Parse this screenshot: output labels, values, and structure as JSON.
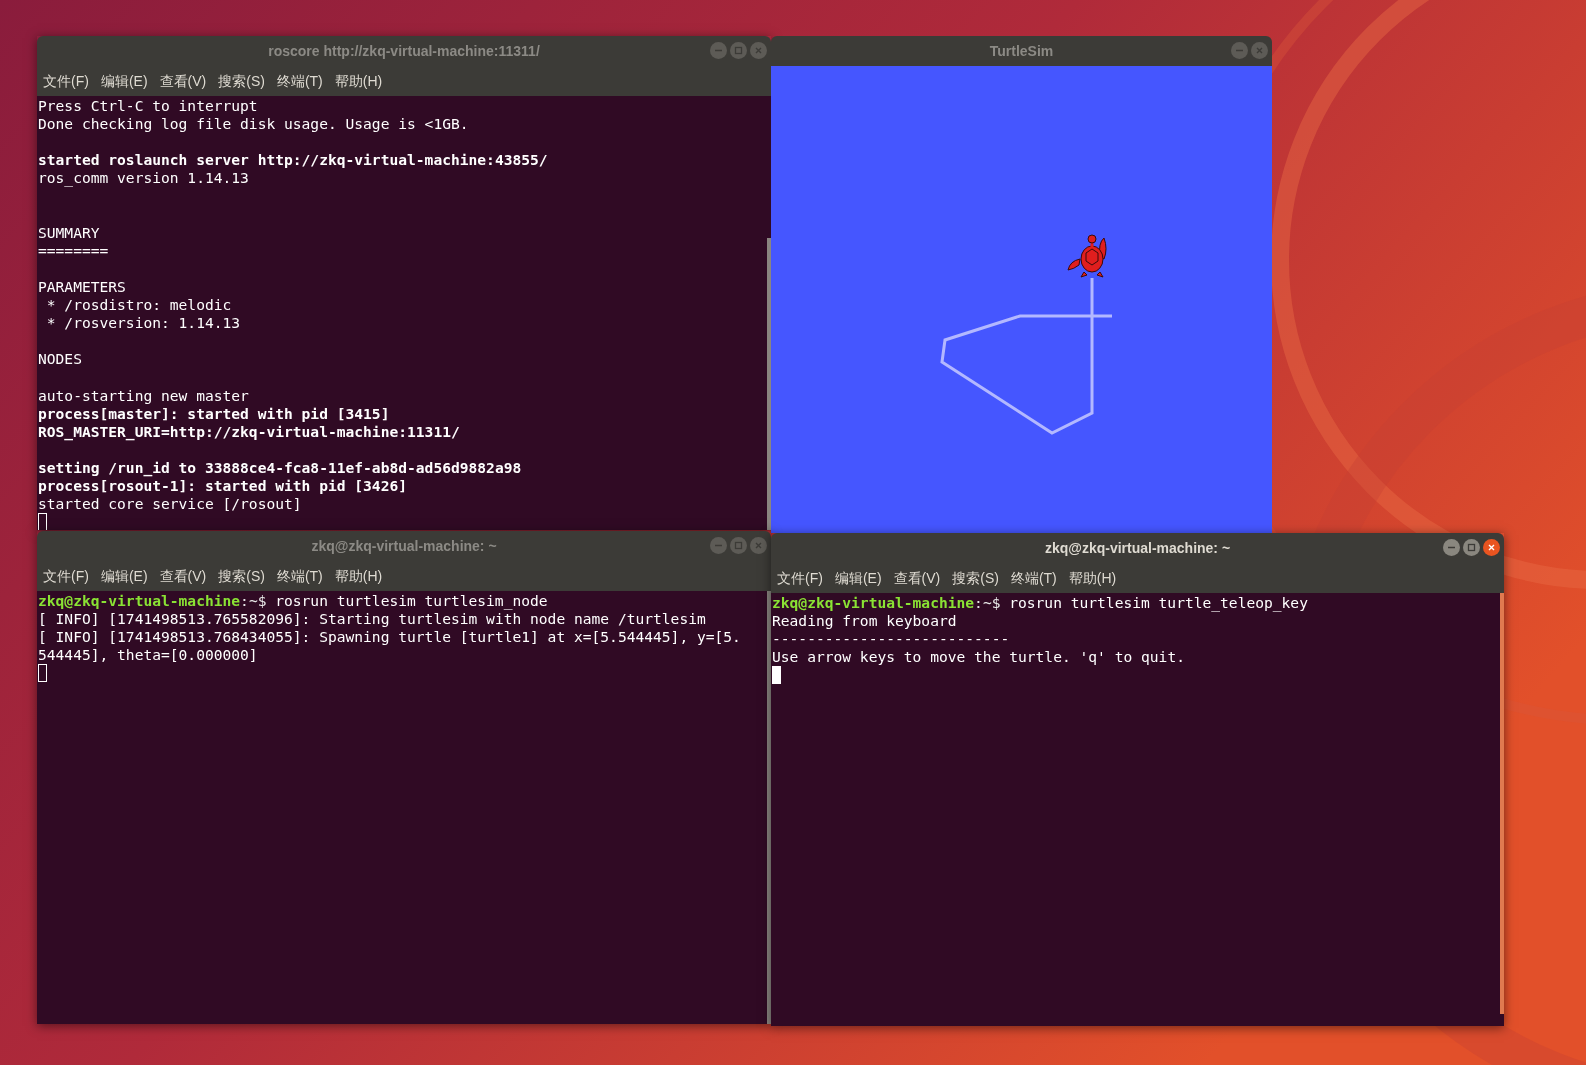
{
  "windows": [
    {
      "kind": "terminal",
      "title": "roscore http://zkq-virtual-machine:11311/",
      "active": false,
      "buttons": [
        {
          "kind": "minimize"
        },
        {
          "kind": "maximize"
        },
        {
          "kind": "close"
        }
      ],
      "menu": [
        "文件(F)",
        "编辑(E)",
        "查看(V)",
        "搜索(S)",
        "终端(T)",
        "帮助(H)"
      ],
      "lines": [
        {
          "kind": "text",
          "text": "Press Ctrl-C to interrupt",
          "bold": false
        },
        {
          "kind": "text",
          "text": "Done checking log file disk usage. Usage is <1GB.",
          "bold": false
        },
        {
          "kind": "blank"
        },
        {
          "kind": "text",
          "text": "started roslaunch server http://zkq-virtual-machine:43855/",
          "bold": true
        },
        {
          "kind": "text",
          "text": "ros_comm version 1.14.13",
          "bold": false
        },
        {
          "kind": "blank"
        },
        {
          "kind": "blank"
        },
        {
          "kind": "text",
          "text": "SUMMARY",
          "bold": false
        },
        {
          "kind": "text",
          "text": "========",
          "bold": false
        },
        {
          "kind": "blank"
        },
        {
          "kind": "text",
          "text": "PARAMETERS",
          "bold": false
        },
        {
          "kind": "text",
          "text": " * /rosdistro: melodic",
          "bold": false
        },
        {
          "kind": "text",
          "text": " * /rosversion: 1.14.13",
          "bold": false
        },
        {
          "kind": "blank"
        },
        {
          "kind": "text",
          "text": "NODES",
          "bold": false
        },
        {
          "kind": "blank"
        },
        {
          "kind": "text",
          "text": "auto-starting new master",
          "bold": false
        },
        {
          "kind": "text",
          "text": "process[master]: started with pid [3415]",
          "bold": true
        },
        {
          "kind": "text",
          "text": "ROS_MASTER_URI=http://zkq-virtual-machine:11311/",
          "bold": true
        },
        {
          "kind": "blank"
        },
        {
          "kind": "text",
          "text": "setting /run_id to 33888ce4-fca8-11ef-ab8d-ad56d9882a98",
          "bold": true
        },
        {
          "kind": "text",
          "text": "process[rosout-1]: started with pid [3426]",
          "bold": true
        },
        {
          "kind": "text",
          "text": "started core service [/rosout]",
          "bold": false
        },
        {
          "kind": "cursor"
        }
      ]
    },
    {
      "kind": "turtlesim",
      "title": "TurtleSim",
      "active": false,
      "buttons": [
        {
          "kind": "minimize"
        },
        {
          "kind": "close"
        }
      ]
    },
    {
      "kind": "terminal",
      "title": "zkq@zkq-virtual-machine: ~",
      "active": false,
      "buttons": [
        {
          "kind": "minimize"
        },
        {
          "kind": "maximize"
        },
        {
          "kind": "close"
        }
      ],
      "menu": [
        "文件(F)",
        "编辑(E)",
        "查看(V)",
        "搜索(S)",
        "终端(T)",
        "帮助(H)"
      ],
      "lines": [
        {
          "kind": "prompt",
          "user": "zkq@zkq-virtual-machine",
          "path": ":~$",
          "command": "rosrun turtlesim turtlesim_node"
        },
        {
          "kind": "text",
          "text": "[ INFO] [1741498513.765582096]: Starting turtlesim with node name /turtlesim",
          "bold": false
        },
        {
          "kind": "text",
          "text": "[ INFO] [1741498513.768434055]: Spawning turtle [turtle1] at x=[5.544445], y=[5.",
          "bold": false
        },
        {
          "kind": "text",
          "text": "544445], theta=[0.000000]",
          "bold": false
        },
        {
          "kind": "cursor"
        }
      ]
    },
    {
      "kind": "terminal",
      "title": "zkq@zkq-virtual-machine: ~",
      "active": true,
      "buttons": [
        {
          "kind": "minimize"
        },
        {
          "kind": "maximize"
        },
        {
          "kind": "close"
        }
      ],
      "menu": [
        "文件(F)",
        "编辑(E)",
        "查看(V)",
        "搜索(S)",
        "终端(T)",
        "帮助(H)"
      ],
      "lines": [
        {
          "kind": "prompt",
          "user": "zkq@zkq-virtual-machine",
          "path": ":~$",
          "command": "rosrun turtlesim turtle_teleop_key"
        },
        {
          "kind": "text",
          "text": "Reading from keyboard",
          "bold": false
        },
        {
          "kind": "text",
          "text": "---------------------------",
          "bold": false
        },
        {
          "kind": "text",
          "text": "Use arrow keys to move the turtle. 'q' to quit.",
          "bold": false
        },
        {
          "kind": "cursor"
        }
      ]
    }
  ]
}
